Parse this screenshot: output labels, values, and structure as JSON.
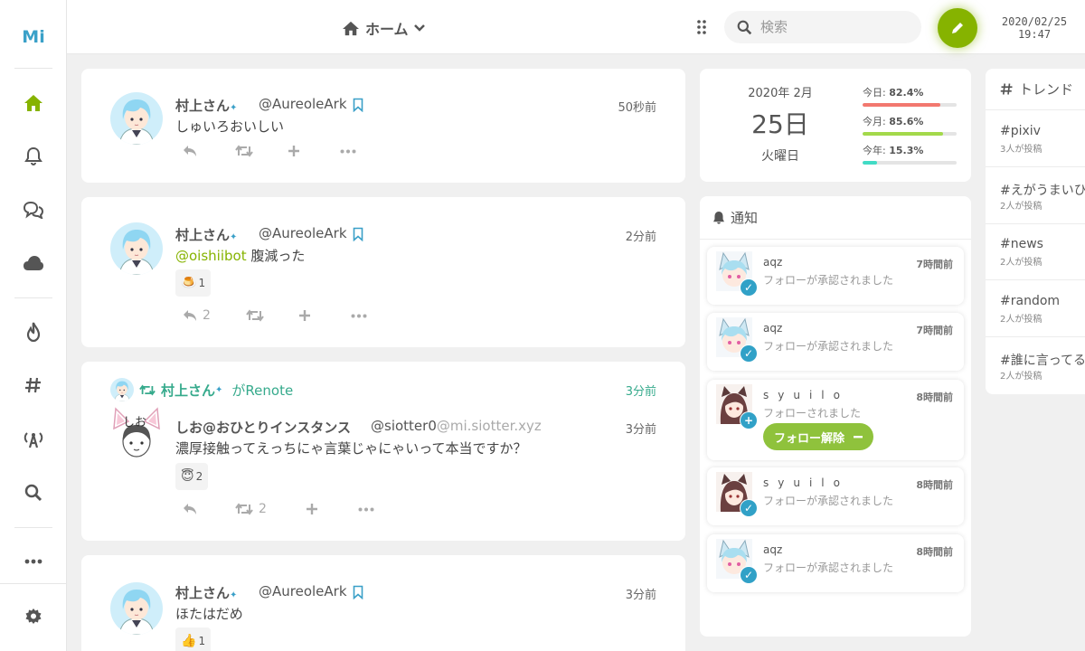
{
  "app": {
    "logo_text": "Mi",
    "accent_color": "#86b300"
  },
  "sidebar": {
    "icons": [
      "logo-icon",
      "home-icon",
      "bell-icon",
      "chat-icon",
      "cloud-icon",
      "fire-icon",
      "hashtag-icon",
      "antenna-icon",
      "search-icon",
      "more-icon",
      "settings-icon"
    ]
  },
  "header": {
    "title": "ホーム",
    "search_placeholder": "検索",
    "date": "2020/02/25",
    "time": "19:47"
  },
  "timeline": [
    {
      "name": "村上さん",
      "acct": "@AureoleArk",
      "time": "50秒前",
      "text": "しゅいろおいしい",
      "reactions": [],
      "reply_count": "",
      "renote_count": ""
    },
    {
      "name": "村上さん",
      "acct": "@AureoleArk",
      "time": "2分前",
      "mention": "@oishiibot",
      "text": " 腹減った",
      "reactions": [
        {
          "emoji": "🍮",
          "count": "1"
        }
      ],
      "reply_count": "2",
      "renote_count": ""
    },
    {
      "renoted_by": "村上さん",
      "renote_label": "がRenote",
      "renote_time": "3分前",
      "name": "しお@おひとりインスタンス",
      "acct": "@siotter0",
      "host": "@mi.siotter.xyz",
      "time": "3分前",
      "text": "濃厚接触ってえっちにゃ言葉じゃにゃいって本当ですか？",
      "reactions": [
        {
          "emoji": "😇",
          "count": "2"
        }
      ],
      "reply_count": "",
      "renote_count": "2",
      "avatar_label": "しお"
    },
    {
      "name": "村上さん",
      "acct": "@AureoleArk",
      "time": "3分前",
      "text": "ほたはだめ",
      "reactions": [
        {
          "emoji": "👍",
          "count": "1"
        }
      ]
    }
  ],
  "calendar": {
    "year_month": "2020年  2月",
    "day": "25日",
    "weekday": "火曜日",
    "meters": [
      {
        "label": "今日:",
        "value": "82.4%",
        "fraction": 0.824,
        "color": "#f2786f"
      },
      {
        "label": "今月:",
        "value": "85.6%",
        "fraction": 0.856,
        "color": "#a3d94a"
      },
      {
        "label": "今年:",
        "value": "15.3%",
        "fraction": 0.153,
        "color": "#41dbc5"
      }
    ]
  },
  "notifications": {
    "title": "通知",
    "items": [
      {
        "user": "aqz",
        "text": "フォローが承認されました",
        "time": "7時間前",
        "badge": "check"
      },
      {
        "user": "aqz",
        "text": "フォローが承認されました",
        "time": "7時間前",
        "badge": "check"
      },
      {
        "user": "syuilo",
        "text": "フォローされました",
        "time": "8時間前",
        "badge": "plus",
        "button": "フォロー解除"
      },
      {
        "user": "syuilo",
        "text": "フォローが承認されました",
        "time": "8時間前",
        "badge": "check"
      },
      {
        "user": "aqz",
        "text": "フォローが承認されました",
        "time": "8時間前",
        "badge": "check"
      }
    ]
  },
  "trends": {
    "title": "トレンド",
    "items": [
      {
        "tag": "#pixiv",
        "count": "3人が投稿"
      },
      {
        "tag": "#えがうまいひ",
        "count": "2人が投稿"
      },
      {
        "tag": "#news",
        "count": "2人が投稿"
      },
      {
        "tag": "#random",
        "count": "2人が投稿"
      },
      {
        "tag": "#誰に言ってる",
        "count": "2人が投稿"
      }
    ]
  }
}
